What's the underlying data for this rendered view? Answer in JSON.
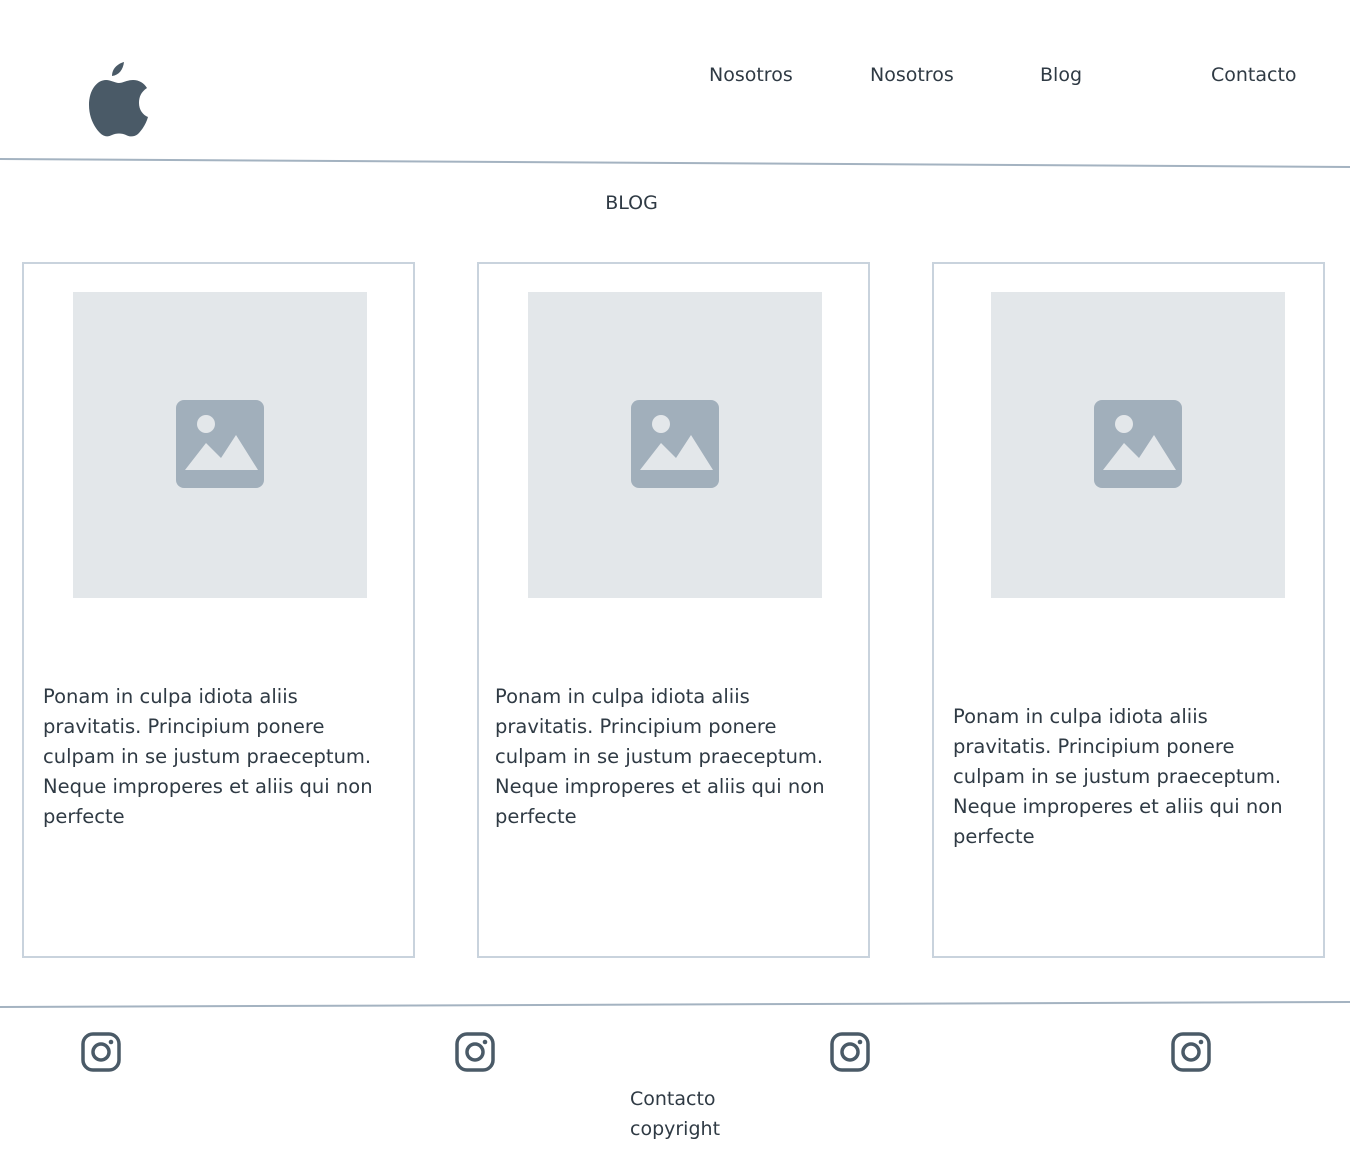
{
  "header": {
    "logo_icon": "apple-logo-icon",
    "nav": [
      "Nosotros",
      "Nosotros",
      "Blog",
      "Contacto"
    ]
  },
  "main": {
    "title": "BLOG",
    "cards": [
      {
        "image_icon": "image-placeholder-icon",
        "text": "Ponam in culpa idiota aliis pravitatis. Principium ponere culpam in se justum praeceptum. Neque improperes et aliis qui non perfecte"
      },
      {
        "image_icon": "image-placeholder-icon",
        "text": "Ponam in culpa idiota aliis pravitatis. Principium ponere culpam in se justum praeceptum. Neque improperes et aliis qui non perfecte"
      },
      {
        "image_icon": "image-placeholder-icon",
        "text": "Ponam in culpa idiota aliis pravitatis. Principium ponere culpam in se justum praeceptum. Neque improperes et aliis qui non perfecte"
      }
    ]
  },
  "footer": {
    "social_icons": [
      "instagram-icon",
      "instagram-icon",
      "instagram-icon",
      "instagram-icon"
    ],
    "contact": "Contacto",
    "copyright": "copyright"
  },
  "colors": {
    "text": "#2f3a44",
    "divider": "#a4b3c1",
    "card_border": "#c9d3dd",
    "placeholder_bg": "#e3e7ea",
    "placeholder_icon": "#a1afbb",
    "icon_dark": "#4a5a67"
  }
}
